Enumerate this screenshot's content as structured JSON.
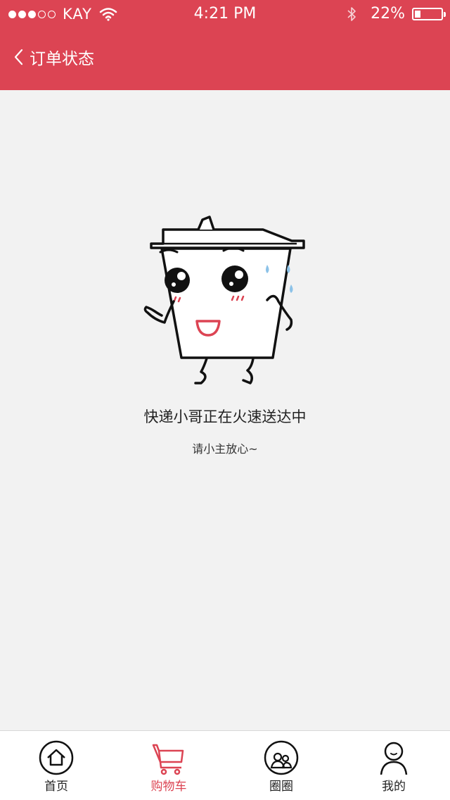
{
  "status_bar": {
    "carrier": "KAY",
    "time": "4:21 PM",
    "battery_percent": "22%",
    "battery_level": 0.22
  },
  "nav": {
    "title": "订单状态"
  },
  "empty_state": {
    "illustration": "delivery-cup-mascot",
    "message": "快递小哥正在火速送达中",
    "sub_message": "请小主放心~"
  },
  "tab_bar": {
    "active_index": 1,
    "active_color": "#dc4453",
    "items": [
      {
        "label": "首页",
        "icon": "home-icon"
      },
      {
        "label": "购物车",
        "icon": "cart-icon"
      },
      {
        "label": "圈圈",
        "icon": "community-icon"
      },
      {
        "label": "我的",
        "icon": "profile-icon"
      }
    ]
  },
  "colors": {
    "brand": "#dc4453",
    "background": "#f2f2f2"
  }
}
